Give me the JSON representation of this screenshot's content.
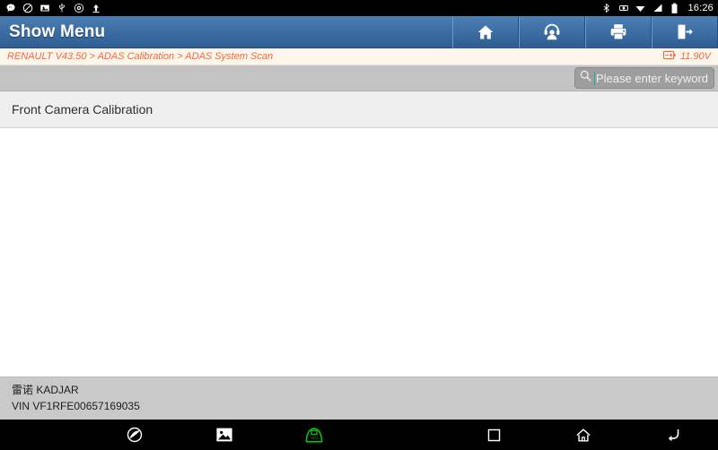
{
  "status_bar": {
    "left_icons": [
      {
        "name": "chat-bubble-icon"
      },
      {
        "name": "no-entry-icon"
      },
      {
        "name": "screenshot-icon"
      },
      {
        "name": "usb-icon"
      },
      {
        "name": "bug-report-icon"
      },
      {
        "name": "upload-arrow-icon"
      }
    ],
    "right_icons": [
      {
        "name": "bluetooth-icon"
      },
      {
        "name": "screen-rotation-icon"
      },
      {
        "name": "wifi-icon"
      },
      {
        "name": "cellular-signal-icon"
      },
      {
        "name": "battery-icon"
      }
    ],
    "time": "16:26"
  },
  "titlebar": {
    "title": "Show Menu",
    "buttons": [
      {
        "name": "home-button",
        "icon": "home-icon"
      },
      {
        "name": "support-button",
        "icon": "headset-icon"
      },
      {
        "name": "print-button",
        "icon": "printer-icon"
      },
      {
        "name": "exit-button",
        "icon": "exit-door-icon"
      }
    ]
  },
  "breadcrumb": {
    "path": "RENAULT V43.50 > ADAS Calibration > ADAS System Scan",
    "voltage": "11.90V",
    "voltage_icon": "battery-voltage-icon"
  },
  "search": {
    "icon": "search-icon",
    "placeholder": "Please enter keyword",
    "value": ""
  },
  "menu": {
    "items": [
      {
        "label": "Front Camera Calibration"
      }
    ]
  },
  "vehicle": {
    "model": "雷诺 KADJAR",
    "vin": "VIN VF1RFE00657169035"
  },
  "nav_bar": {
    "items": [
      {
        "name": "browser-icon"
      },
      {
        "name": "gallery-icon"
      },
      {
        "name": "vci-connector-icon",
        "label": "VCI"
      },
      {
        "name": "recents-icon"
      },
      {
        "name": "android-home-icon"
      },
      {
        "name": "back-icon"
      }
    ]
  },
  "colors": {
    "titlebar_blue": "#3d6fa5",
    "breadcrumb_orange": "#f2673a",
    "vci_green": "#12b512",
    "caret_teal": "#17b0a0"
  }
}
